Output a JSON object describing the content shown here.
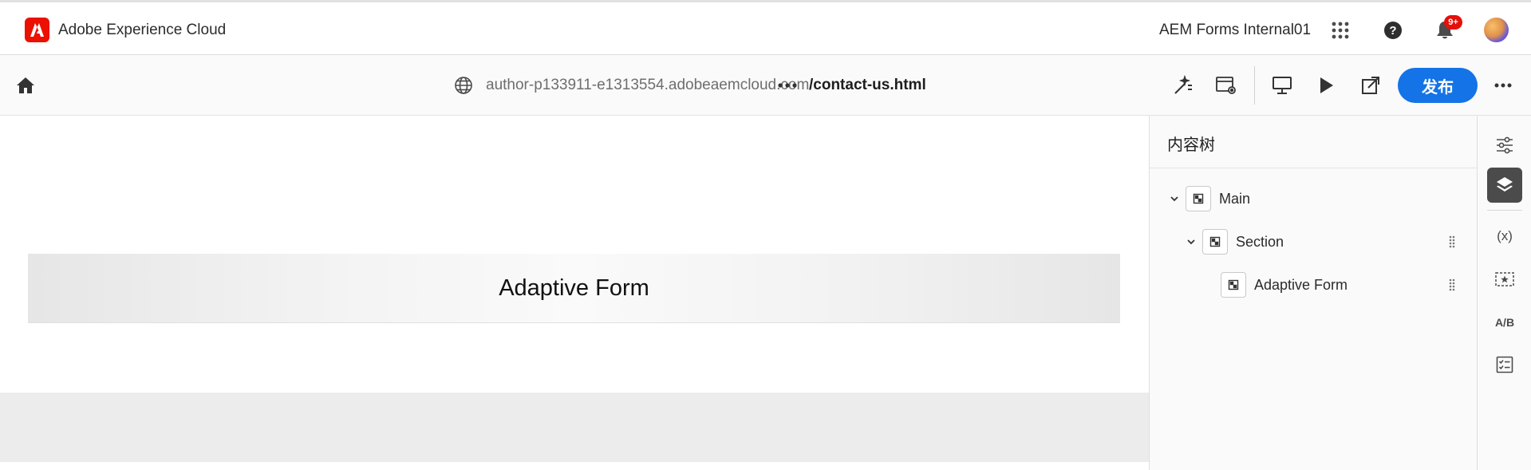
{
  "shell": {
    "brand": "Adobe Experience Cloud",
    "org": "AEM Forms Internal01",
    "notifications_badge": "9+",
    "icons": [
      "adobe-logo-icon",
      "apps-grid-icon",
      "help-icon",
      "bell-icon",
      "avatar"
    ]
  },
  "toolbar": {
    "url": "author-p133911-e1313554.adobeaemcloud.com",
    "path": "/contact-us.html",
    "publish_label": "发布",
    "icons": [
      "home-icon",
      "globe-icon",
      "more-horizontal-icon",
      "edit-wand-icon",
      "page-settings-icon",
      "desktop-icon",
      "play-icon",
      "open-external-icon",
      "more-menu-icon"
    ]
  },
  "canvas": {
    "form_title": "Adaptive Form"
  },
  "content_tree": {
    "title": "内容树",
    "nodes": [
      {
        "label": "Main"
      },
      {
        "label": "Section"
      },
      {
        "label": "Adaptive Form"
      }
    ]
  },
  "rail": {
    "ab_label": "A/B",
    "variables_label": "(x)",
    "icons": [
      "properties-icon",
      "layers-icon",
      "variables-icon",
      "rule-icon",
      "ab-test-icon",
      "checklist-icon"
    ]
  },
  "colors": {
    "accent": "#1473e6",
    "adobe_red": "#eb1000",
    "badge": "#e3100b"
  }
}
